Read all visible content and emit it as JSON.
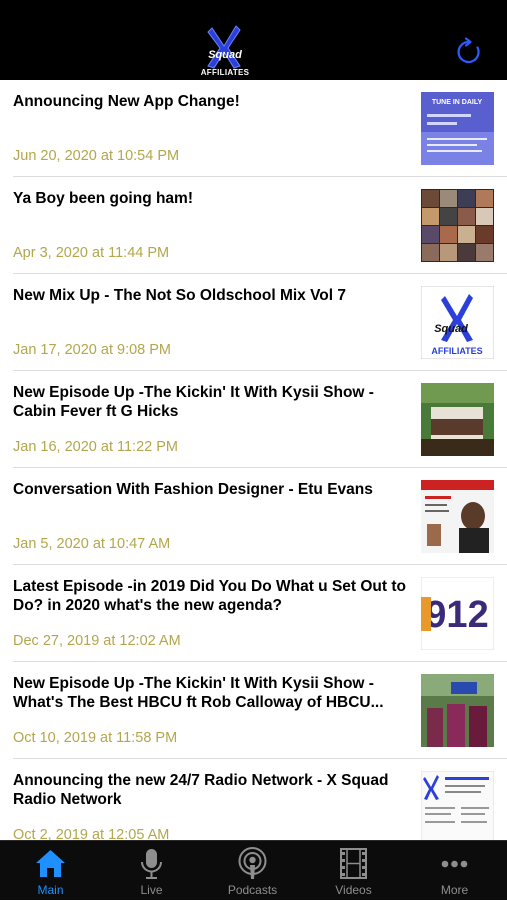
{
  "header": {
    "logo_text": "Squad AFFILIATES",
    "refresh_icon": "refresh-icon",
    "accent_color": "#2b5cff"
  },
  "posts": [
    {
      "title": "Announcing New App Change!",
      "date": "Jun 20, 2020 at 10:54 PM"
    },
    {
      "title": "Ya Boy been going ham!",
      "date": "Apr 3, 2020 at 11:44 PM"
    },
    {
      "title": "New Mix Up - The Not So Oldschool Mix Vol 7",
      "date": "Jan 17, 2020 at 9:08 PM"
    },
    {
      "title": "New Episode Up -The Kickin' It With Kysii Show - Cabin Fever ft G Hicks",
      "date": "Jan 16, 2020 at 11:22 PM"
    },
    {
      "title": "Conversation With Fashion Designer - Etu Evans",
      "date": "Jan 5, 2020 at 10:47 AM"
    },
    {
      "title": "Latest Episode -in 2019 Did You Do What u Set Out to Do? in 2020 what's the new agenda?",
      "date": "Dec 27, 2019 at 12:02 AM"
    },
    {
      "title": "New Episode Up -The Kickin' It With Kysii Show - What's The Best HBCU ft Rob Calloway of HBCU...",
      "date": "Oct 10, 2019 at 11:58 PM"
    },
    {
      "title": "Announcing the new 24/7 Radio Network - X Squad Radio Network",
      "date": "Oct 2, 2019 at 12:05 AM"
    }
  ],
  "thumb_texts": {
    "tune_in": "TUNE IN DAILY",
    "affiliates": "AFFILIATES",
    "year": "912"
  },
  "tabs": [
    {
      "label": "Main",
      "icon": "home-icon",
      "active": true
    },
    {
      "label": "Live",
      "icon": "microphone-icon",
      "active": false
    },
    {
      "label": "Podcasts",
      "icon": "podcast-icon",
      "active": false
    },
    {
      "label": "Videos",
      "icon": "film-icon",
      "active": false
    },
    {
      "label": "More",
      "icon": "more-dots-icon",
      "active": false
    }
  ],
  "colors": {
    "tab_active": "#1e90ff",
    "tab_inactive": "#8e8e8e",
    "date_text": "#b3a64c"
  }
}
